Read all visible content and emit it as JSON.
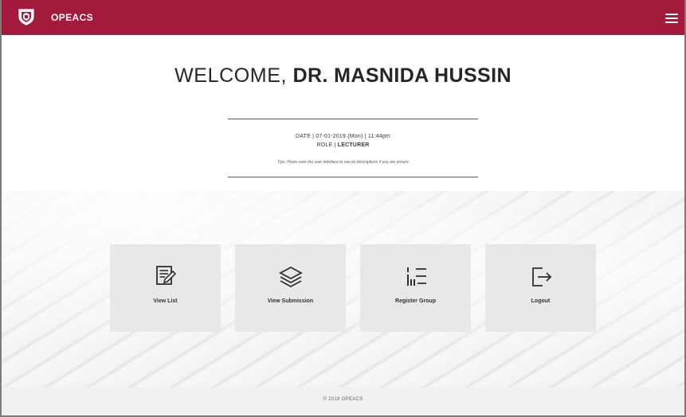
{
  "app": {
    "name": "OPEACS",
    "brand_color": "#a31a3c"
  },
  "header": {
    "logo_icon": "opeacs-shield-logo",
    "menu_icon": "hamburger-menu-icon"
  },
  "welcome": {
    "prefix": "WELCOME,",
    "name": "DR. MASNIDA HUSSIN",
    "date_line": "DATE | 07-01-2019 (Mon) | 11:44pm",
    "role_label": "ROLE |",
    "role_value": "LECTURER",
    "tip": "Tips: Hover over the user interface to see its descriptions if you are unsure"
  },
  "tiles": [
    {
      "label": "View List",
      "icon": "edit-list-icon"
    },
    {
      "label": "View Submission",
      "icon": "layers-icon"
    },
    {
      "label": "Register Group",
      "icon": "group-list-icon"
    },
    {
      "label": "Logout",
      "icon": "logout-icon"
    }
  ],
  "footer": {
    "text": "© 2018 OPEACS"
  }
}
